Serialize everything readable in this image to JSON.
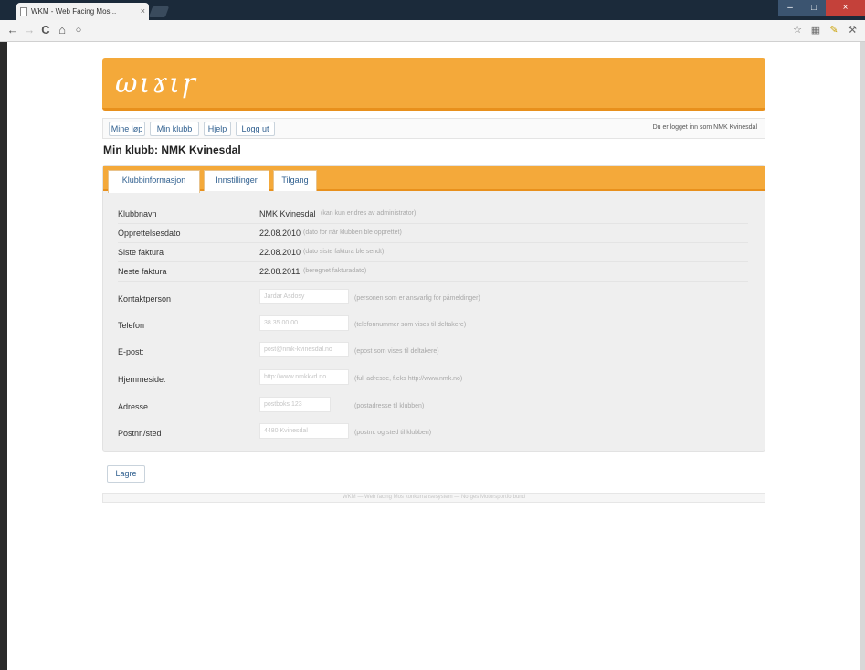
{
  "browser": {
    "tab_title": "WKM - Web Facing Mos...",
    "tab_close": "×",
    "window_minimize": "–",
    "window_maximize": "□",
    "window_close": "×",
    "nav_back": "←",
    "nav_forward": "→",
    "nav_reload": "C",
    "nav_home": "⌂",
    "nav_info": "○",
    "star": "☆",
    "ext1": "▦",
    "ext2": "✎",
    "wrench": "⚒"
  },
  "site": {
    "logo_text": "ωιɤιɼ"
  },
  "menu": {
    "items": [
      "Mine løp",
      "Min klubb",
      "Hjelp",
      "Logg ut"
    ],
    "logged_in_text": "Du er logget inn som NMK Kvinesdal"
  },
  "page_title": "Min klubb: NMK Kvinesdal",
  "tabs": {
    "items": [
      "Klubbinformasjon",
      "Innstillinger",
      "Tilgang"
    ],
    "active_index": 0
  },
  "info_rows": [
    {
      "label": "Klubbnavn",
      "value": "NMK Kvinesdal",
      "hint": "(kan kun endres av administrator)"
    },
    {
      "label": "Opprettelsesdato",
      "value": "22.08.2010",
      "hint": "(dato for når klubben ble opprettet)"
    },
    {
      "label": "Siste faktura",
      "value": "22.08.2010",
      "hint": "(dato siste faktura ble sendt)"
    },
    {
      "label": "Neste faktura",
      "value": "22.08.2011",
      "hint": "(beregnet fakturadato)"
    }
  ],
  "form_rows": [
    {
      "label": "Kontaktperson",
      "value": "Jardar Asdosy",
      "hint": "(personen som er ansvarlig for påmeldinger)"
    },
    {
      "label": "Telefon",
      "value": "38 35 00 00",
      "hint": "(telefonnummer som vises til deltakere)"
    },
    {
      "label": "E-post:",
      "value": "post@nmk-kvinesdal.no",
      "hint": "(epost som vises til deltakere)"
    },
    {
      "label": "Hjemmeside:",
      "value": "http://www.nmkkvd.no",
      "hint": "(full adresse, f.eks http://www.nmk.no)"
    },
    {
      "label": "Adresse",
      "value": "postboks 123",
      "hint": "(postadresse til klubben)"
    },
    {
      "label": "Postnr./sted",
      "value": "4480 Kvinesdal",
      "hint": "(postnr. og sted til klubben)"
    }
  ],
  "save_label": "Lagre",
  "footer_text": "WKM — Web facing Mos konkurransesystem — Norges Motorsportforbund"
}
